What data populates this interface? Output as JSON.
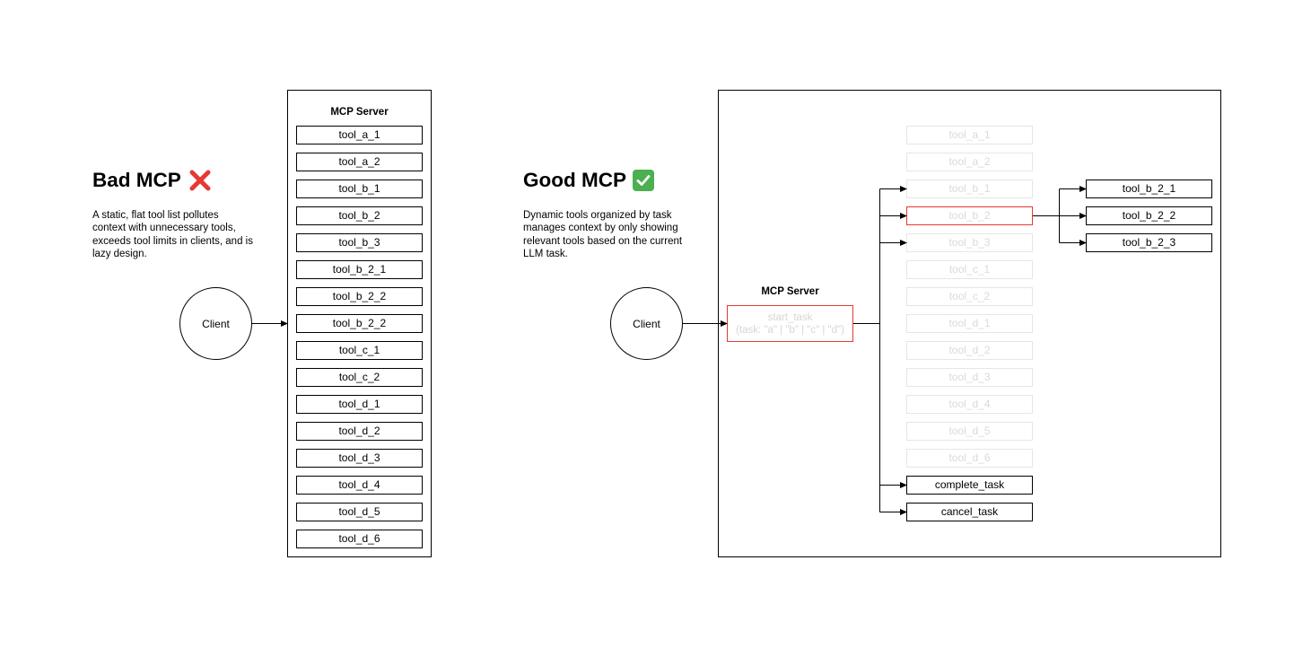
{
  "bad": {
    "title": "Bad MCP",
    "cross_icon": "red-cross-mark-icon",
    "description": "A static, flat tool list pollutes context with unnecessary tools, exceeds tool limits in clients, and is lazy design.",
    "client_label": "Client",
    "server_label": "MCP Server",
    "tools": [
      "tool_a_1",
      "tool_a_2",
      "tool_b_1",
      "tool_b_2",
      "tool_b_3",
      "tool_b_2_1",
      "tool_b_2_2",
      "tool_b_2_2",
      "tool_c_1",
      "tool_c_2",
      "tool_d_1",
      "tool_d_2",
      "tool_d_3",
      "tool_d_4",
      "tool_d_5",
      "tool_d_6"
    ]
  },
  "good": {
    "title": "Good MCP",
    "check_icon": "green-check-mark-icon",
    "description": "Dynamic tools organized by task manages context by only showing relevant tools based on the current LLM task.",
    "client_label": "Client",
    "server_label": "MCP Server",
    "start_task": {
      "name": "start_task",
      "signature": "(task: \"a\" | \"b\" | \"c\" | \"d\")"
    },
    "tools": [
      {
        "label": "tool_a_1",
        "state": "faded"
      },
      {
        "label": "tool_a_2",
        "state": "faded"
      },
      {
        "label": "tool_b_1",
        "state": "faded"
      },
      {
        "label": "tool_b_2",
        "state": "selected"
      },
      {
        "label": "tool_b_3",
        "state": "faded"
      },
      {
        "label": "tool_c_1",
        "state": "faded"
      },
      {
        "label": "tool_c_2",
        "state": "faded"
      },
      {
        "label": "tool_d_1",
        "state": "faded"
      },
      {
        "label": "tool_d_2",
        "state": "faded"
      },
      {
        "label": "tool_d_3",
        "state": "faded"
      },
      {
        "label": "tool_d_4",
        "state": "faded"
      },
      {
        "label": "tool_d_5",
        "state": "faded"
      },
      {
        "label": "tool_d_6",
        "state": "faded"
      },
      {
        "label": "complete_task",
        "state": "active"
      },
      {
        "label": "cancel_task",
        "state": "active"
      }
    ],
    "subtools": [
      "tool_b_2_1",
      "tool_b_2_2",
      "tool_b_2_3"
    ]
  },
  "colors": {
    "highlight_red": "#e53935",
    "faded_border": "#e6e6e6",
    "faded_text": "#dadada",
    "check_green": "#4caf50"
  }
}
